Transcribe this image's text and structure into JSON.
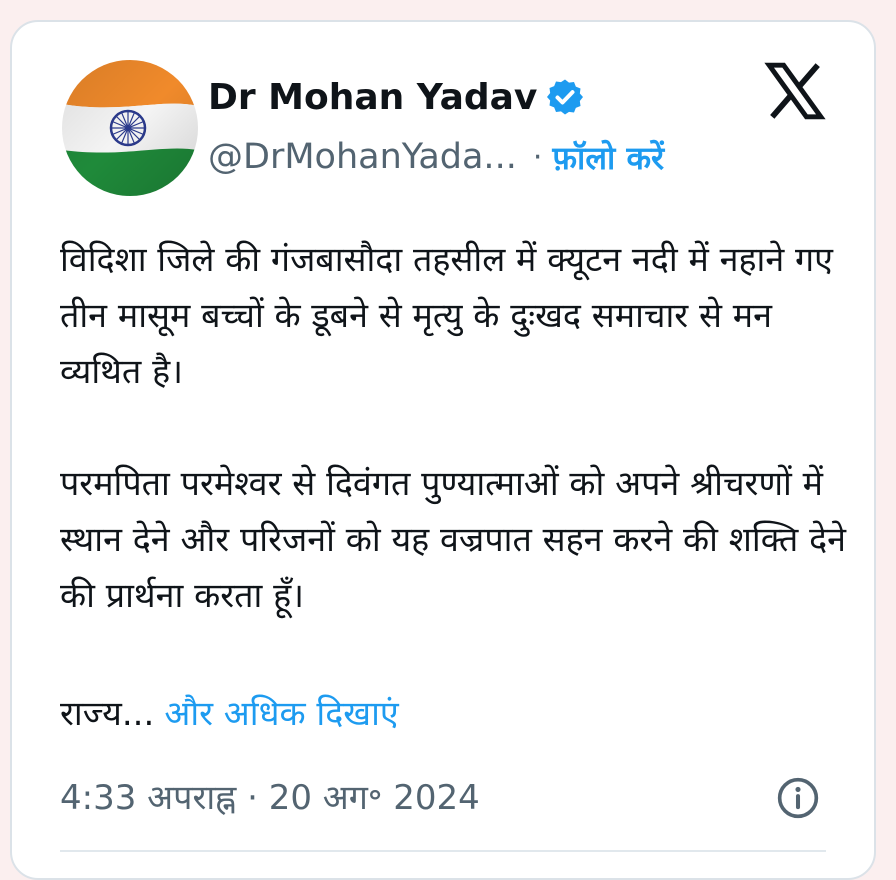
{
  "author": {
    "name": "Dr Mohan Yadav",
    "handle": "@DrMohanYada...",
    "follow_label": "फ़ॉलो करें",
    "separator": "·",
    "avatar_icon": "indian-flag-avatar",
    "verified_icon": "verified-badge-icon"
  },
  "platform": {
    "logo_icon": "x-logo-icon"
  },
  "tweet": {
    "paragraph_1": "विदिशा जिले की गंजबासौदा तहसील में क्यूटन नदी में नहाने गए तीन मासूम बच्चों के डूबने से मृत्यु के दुःखद समाचार से मन व्यथित है।",
    "paragraph_2": "परमपिता परमेश्वर से दिवंगत पुण्यात्माओं को अपने श्रीचरणों में स्थान देने और परिजनों को यह वज्रपात सहन करने की शक्ति देने की प्रार्थना करता हूँ।",
    "truncated_text": "राज्य...",
    "show_more_label": "और अधिक दिखाएं"
  },
  "meta": {
    "timestamp": "4:33 अपराह्न · 20 अग॰ 2024",
    "info_icon": "info-icon"
  },
  "colors": {
    "accent": "#1d9bf0",
    "text": "#0f1419",
    "muted": "#536471",
    "page_bg": "#fbefef"
  }
}
